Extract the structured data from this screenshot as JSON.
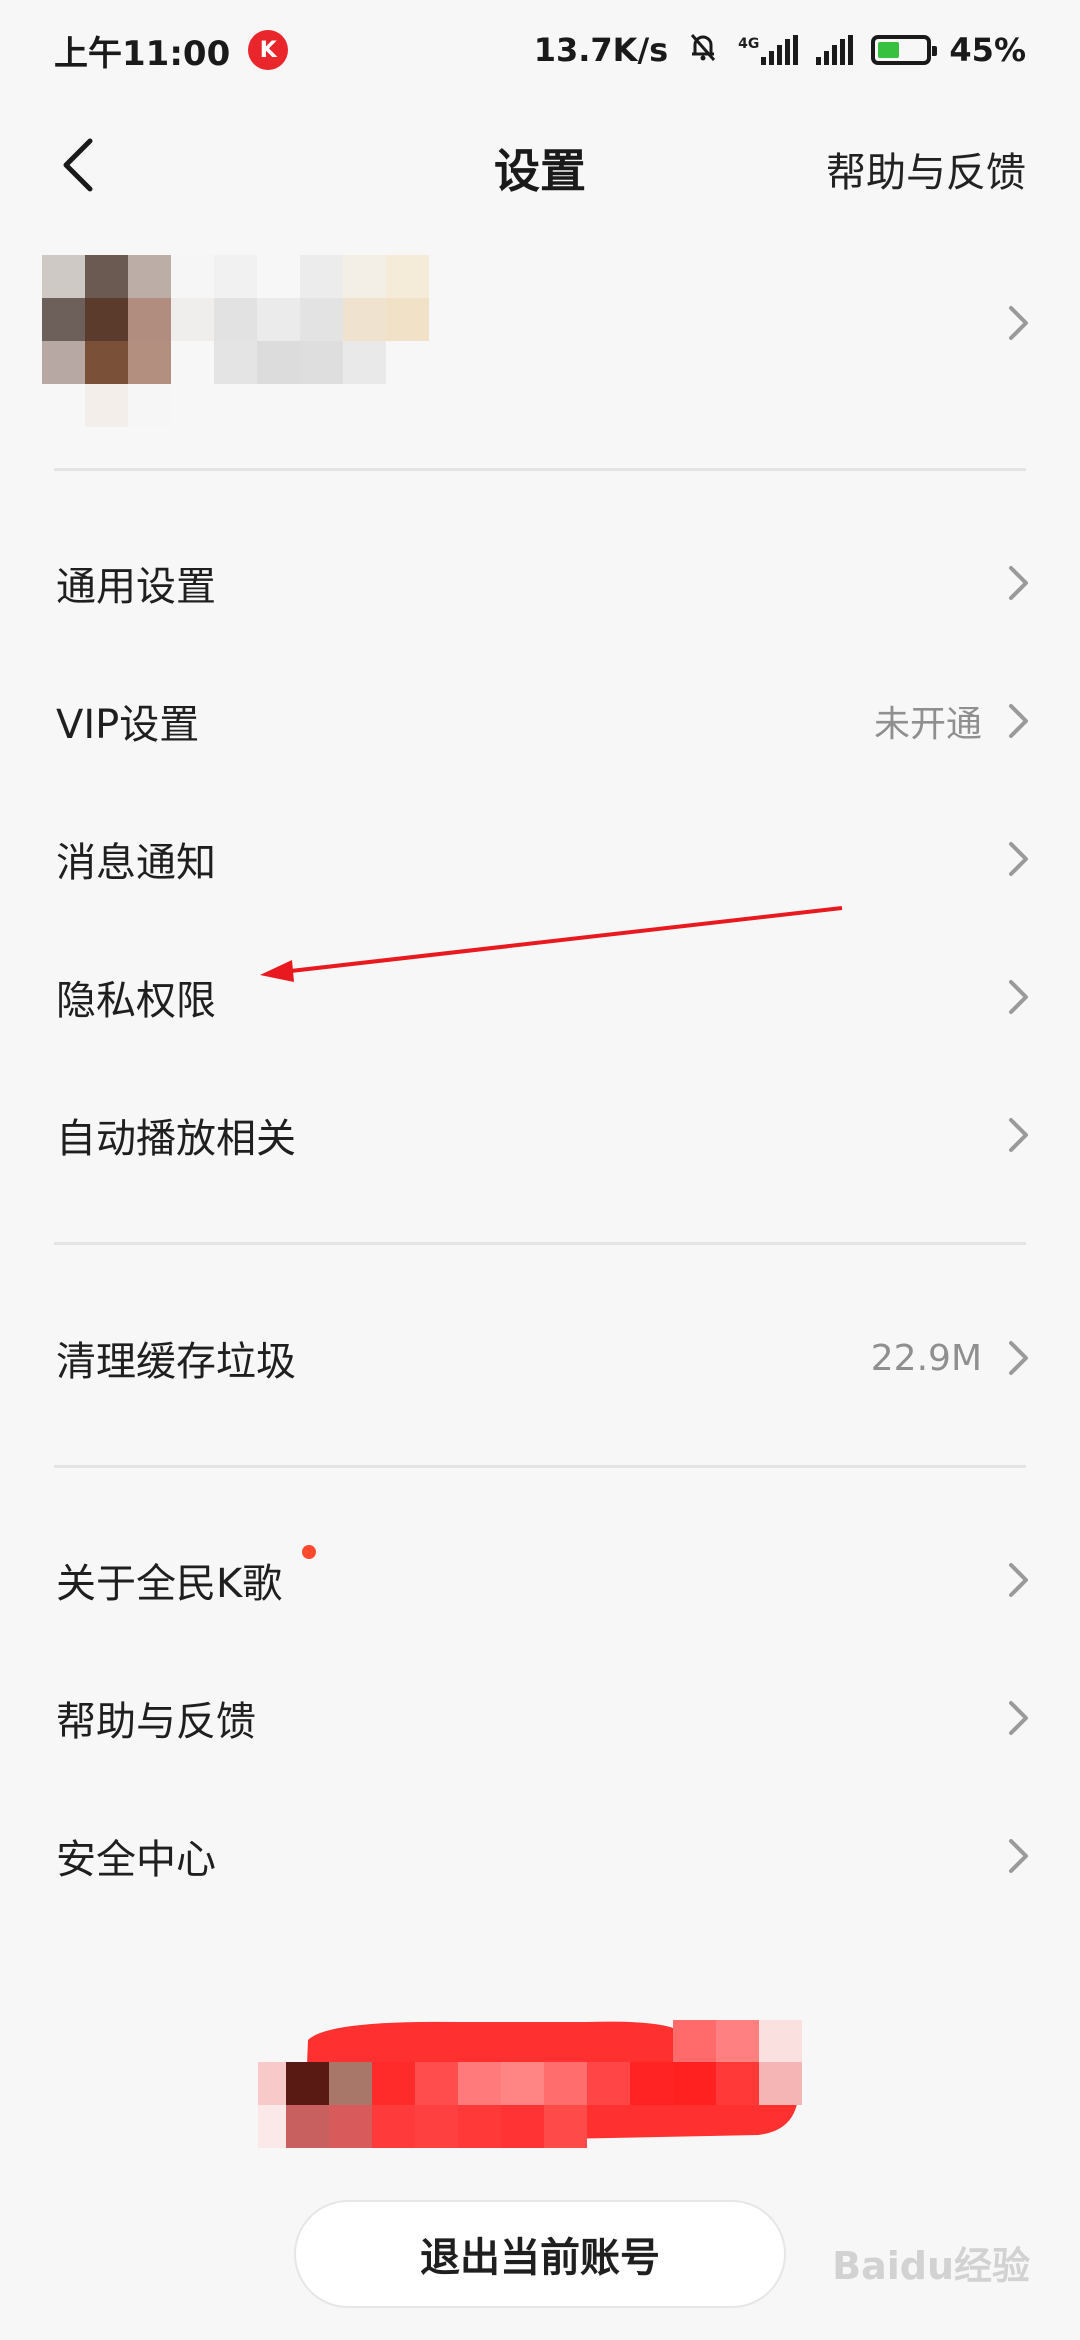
{
  "status_bar": {
    "time": "上午11:00",
    "net_speed": "13.7K/s",
    "network_type": "4G",
    "battery_percent": "45%",
    "battery_level": 0.45,
    "app_icon": "kge-app-icon",
    "mute_icon": "bell-off-icon"
  },
  "header": {
    "title": "设置",
    "help_link": "帮助与反馈"
  },
  "menu": {
    "general": {
      "label": "通用设置"
    },
    "vip": {
      "label": "VIP设置",
      "value": "未开通"
    },
    "notifications": {
      "label": "消息通知"
    },
    "privacy": {
      "label": "隐私权限"
    },
    "autoplay": {
      "label": "自动播放相关"
    },
    "cache": {
      "label": "清理缓存垃圾",
      "value": "22.9M"
    },
    "about": {
      "label": "关于全民K歌"
    },
    "help": {
      "label": "帮助与反馈"
    },
    "security": {
      "label": "安全中心"
    }
  },
  "logout": {
    "label": "退出当前账号"
  },
  "watermark": "Baidu经验",
  "colors": {
    "accent_red": "#ff2a2a",
    "badge_dot": "#ff4a2d",
    "background": "#f7f7f7"
  }
}
